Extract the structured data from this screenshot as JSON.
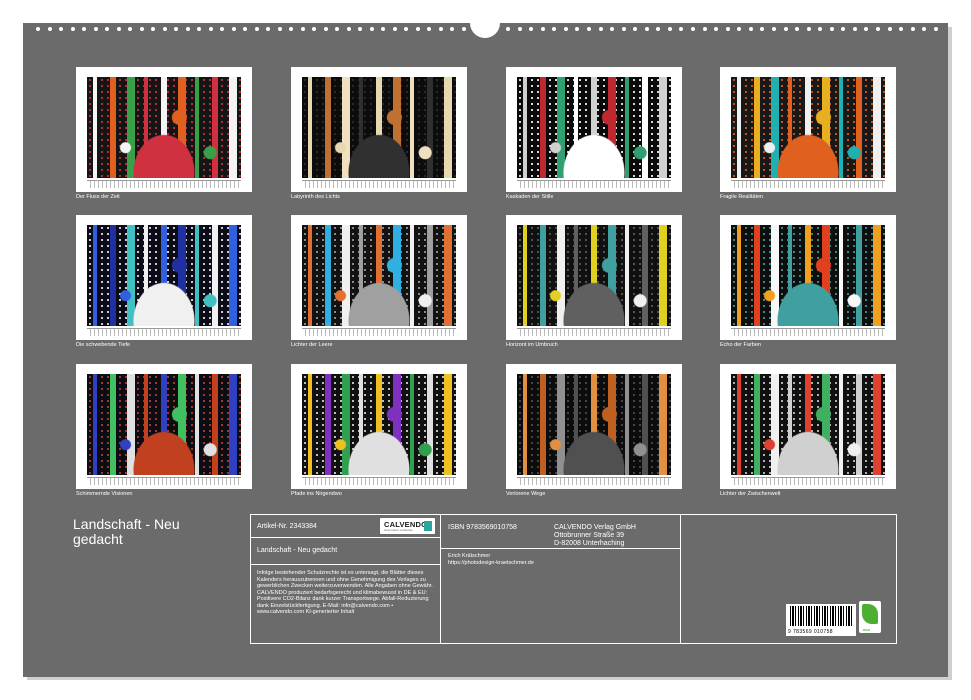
{
  "calendar": {
    "title": "Landschaft - Neu gedacht",
    "thumbnails": [
      {
        "caption": "Der Fluss der Zeit",
        "palette": [
          "#f4f4f4",
          "#e06020",
          "#3aa048",
          "#d03040",
          "#151515"
        ]
      },
      {
        "caption": "Labyrinth des Lichts",
        "palette": [
          "#e8d8b0",
          "#c07030",
          "#f0e0c0",
          "#303030",
          "#0c0c0c"
        ]
      },
      {
        "caption": "Kaskaden der Stille",
        "palette": [
          "#d0d0d0",
          "#c02830",
          "#30a070",
          "#ffffff",
          "#0a0a0a"
        ]
      },
      {
        "caption": "Fragile Realitäten",
        "palette": [
          "#f0f0f0",
          "#e8b020",
          "#20b0b0",
          "#e06020",
          "#181818"
        ]
      },
      {
        "caption": "Die schwebende Tiefe",
        "palette": [
          "#3060e0",
          "#2030a0",
          "#40c0c0",
          "#f0f0f0",
          "#0c0c18"
        ]
      },
      {
        "caption": "Lichter der Leere",
        "palette": [
          "#e07030",
          "#30b0e0",
          "#f0f0f0",
          "#a0a0a0",
          "#121212"
        ]
      },
      {
        "caption": "Horizont im Umbruch",
        "palette": [
          "#e0d020",
          "#40a0a0",
          "#f0f0f0",
          "#606060",
          "#101010"
        ]
      },
      {
        "caption": "Echo der Farben",
        "palette": [
          "#f0a020",
          "#e04020",
          "#f8f8f8",
          "#40a0a0",
          "#0e0e0e"
        ]
      },
      {
        "caption": "Schimmernde Visionen",
        "palette": [
          "#3040c0",
          "#40c060",
          "#e0e0e0",
          "#c04020",
          "#0c0c14"
        ]
      },
      {
        "caption": "Pfade ins Nirgendwo",
        "palette": [
          "#f0c020",
          "#8030c0",
          "#30a050",
          "#e0e0e0",
          "#101010"
        ]
      },
      {
        "caption": "Verlorene Wege",
        "palette": [
          "#e09040",
          "#c06020",
          "#909090",
          "#505050",
          "#0c0c0c"
        ]
      },
      {
        "caption": "Lichter der Zwischenwelt",
        "palette": [
          "#e04030",
          "#40b060",
          "#f0f0f0",
          "#d0d0d0",
          "#101010"
        ]
      }
    ]
  },
  "info": {
    "article_no": "Artikel-Nr. 2343384",
    "publisher_logo": "CALVENDO",
    "publisher_tagline": "Gute Ideen verbreiten",
    "product_title": "Landschaft - Neu gedacht",
    "legal_text": "Infolge bestehender Schutzrechte ist es untersagt, die Blätter dieses Kalenders herauszutrennen und ohne Genehmigung des Verlages zu gewerblichen Zwecken weiterzuverwenden. Alle Angaben ohne Gewähr. CALVENDO produziert bedarfsgerecht und klimabewusst in DE & EU: Positivere CO2-Bilanz dank kurzer Transportwege. Abfall-Reduzierung dank Einzelstückfertigung. E-Mail: info@calvendo.com • www.calvendo.com KI-generierter Inhalt",
    "isbn": "ISBN 9783569010758",
    "author_name": "Erich Krätschmer",
    "author_url": "https://photodesign-kraetschmer.de",
    "publisher_name": "CALVENDO Verlag GmbH",
    "publisher_street": "Ottobrunner Straße 39",
    "publisher_city": "D-82008 Unterhaching",
    "barcode_number": "9 783569 010758",
    "eco_label": "eco"
  }
}
